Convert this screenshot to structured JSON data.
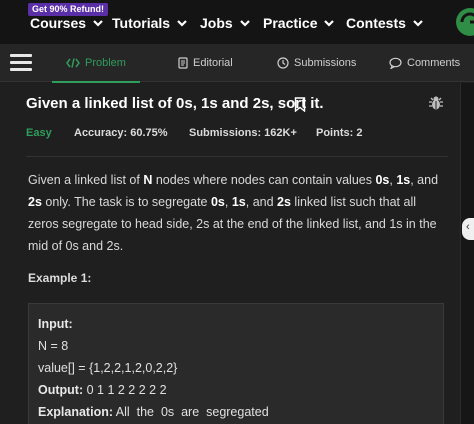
{
  "nav": {
    "promo": "Get 90% Refund!",
    "items": [
      "Courses",
      "Tutorials",
      "Jobs",
      "Practice",
      "Contests"
    ]
  },
  "tabs": [
    {
      "label": "Problem",
      "icon": "code-icon",
      "active": true
    },
    {
      "label": "Editorial",
      "icon": "document-icon"
    },
    {
      "label": "Submissions",
      "icon": "clock-icon"
    },
    {
      "label": "Comments",
      "icon": "comment-icon"
    }
  ],
  "problem": {
    "title": "Given a linked list of 0s, 1s and 2s, sort it.",
    "difficulty": "Easy",
    "accuracy": "Accuracy: 60.75%",
    "submissions": "Submissions: 162K+",
    "points": "Points: 2",
    "description": {
      "p1": "Given a linked list of ",
      "b1": "N",
      "p2": " nodes where nodes can contain values ",
      "b2": "0s",
      "p3": ", ",
      "b3": "1s",
      "p4": ", and ",
      "b4": "2s",
      "p5": " only. The task is to segregate ",
      "b5": "0s",
      "p6": ", ",
      "b6": "1s",
      "p7": ", and ",
      "b7": "2s",
      "p8": " linked list such that all zeros segregate to head side, 2s at the end of the linked list, and 1s in the mid of 0s and 2s."
    },
    "example_heading": "Example 1:",
    "example": {
      "input_label": "Input:",
      "n_line": "N = 8",
      "value_line": "value[] = {1,2,2,1,2,0,2,2}",
      "output_label": "Output:",
      "output_value": " 0 1 1 2 2 2 2 2",
      "explanation_label": "Explanation:",
      "explanation_value": " All  the  0s  are  segregated"
    }
  },
  "colors": {
    "accent": "#2f9d5c",
    "promo": "#5a2ea6"
  }
}
